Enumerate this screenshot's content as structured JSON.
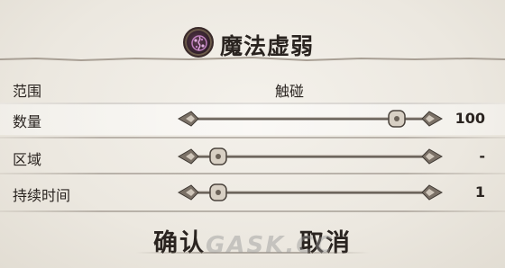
{
  "dialog": {
    "title": "魔法虚弱",
    "spell_icon": "curse-icon"
  },
  "rows": [
    {
      "label": "范围",
      "value": "触碰"
    },
    {
      "label": "数量",
      "value": "100",
      "slider_fraction": 1.0
    },
    {
      "label": "区域",
      "value": "-",
      "slider_fraction": 0.0
    },
    {
      "label": "持续时间",
      "value": "1",
      "slider_fraction": 0.0
    }
  ],
  "buttons": {
    "confirm": "确认",
    "cancel": "取消"
  },
  "watermark": "GASK.CC",
  "colors": {
    "background": "#ece8e0",
    "text": "#2a2420",
    "slider_metal": "#6b6258"
  }
}
